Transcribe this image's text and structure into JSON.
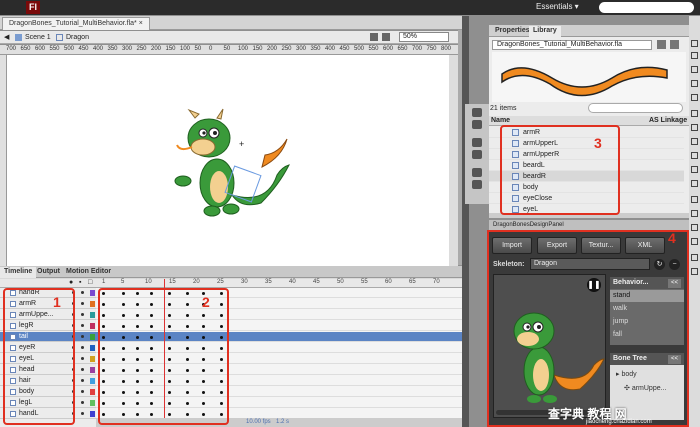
{
  "app": {
    "logo": "Fl",
    "workspace": "Essentials ▾"
  },
  "document": {
    "tab": "DragonBones_Tutorial_MultiBehavior.fla*",
    "close": "×"
  },
  "editbar": {
    "scene": "Scene 1",
    "symbol": "Dragon",
    "zoom": "50%"
  },
  "ruler": [
    "700",
    "650",
    "600",
    "550",
    "500",
    "450",
    "400",
    "350",
    "300",
    "250",
    "200",
    "150",
    "100",
    "50",
    "0",
    "50",
    "100",
    "150",
    "200",
    "250",
    "300",
    "350",
    "400",
    "450",
    "500",
    "550",
    "600",
    "650",
    "700",
    "750",
    "800"
  ],
  "timeline": {
    "tabs": [
      "Timeline",
      "Output",
      "Motion Editor"
    ],
    "frame_numbers": [
      "1",
      "5",
      "10",
      "15",
      "20",
      "25",
      "30",
      "35",
      "40",
      "45",
      "50",
      "55",
      "60",
      "65",
      "70"
    ],
    "layers": [
      "handR",
      "armR",
      "armUppe...",
      "legR",
      "tail",
      "eyeR",
      "eyeL",
      "head",
      "hair",
      "body",
      "legL",
      "handL"
    ],
    "selected_layer": 4,
    "footer": {
      "fps": "10.00 fps",
      "time": "1.2 s"
    }
  },
  "panel": {
    "tabs": [
      "Properties",
      "Library"
    ],
    "active_tab": "Library",
    "library_file": "DragonBones_Tutorial_MultiBehavior.fla",
    "count": "21 items",
    "columns": {
      "name": "Name",
      "linkage": "AS Linkage"
    },
    "items": [
      "armR",
      "armUpperL",
      "armUpperR",
      "beardL",
      "beardR",
      "body",
      "eyeClose",
      "eyeL"
    ],
    "selected_item": 4
  },
  "dragonbones": {
    "title": "DragonBonesDesignPanel",
    "buttons": [
      "Import",
      "Export",
      "Textur...",
      "XML"
    ],
    "skeleton_label": "Skeleton:",
    "skeleton": "Dragon",
    "behavior_header": "Behavior...",
    "behaviors": [
      "stand",
      "walk",
      "jump",
      "fall"
    ],
    "selected_behavior": 0,
    "bone_header": "Bone Tree",
    "bones": [
      "body",
      "armUppe..."
    ],
    "nav": "<<",
    "play": "❚❚"
  },
  "annotations": [
    "1",
    "2",
    "3",
    "4"
  ],
  "watermark": {
    "main": "查字典 教程 网",
    "url": "jiaocheng.chazidian.com"
  },
  "colors": {
    "accent": "#e03020",
    "selection": "#5b84c4",
    "dragon_green": "#3a9a3a",
    "tail_orange": "#f08a20"
  }
}
